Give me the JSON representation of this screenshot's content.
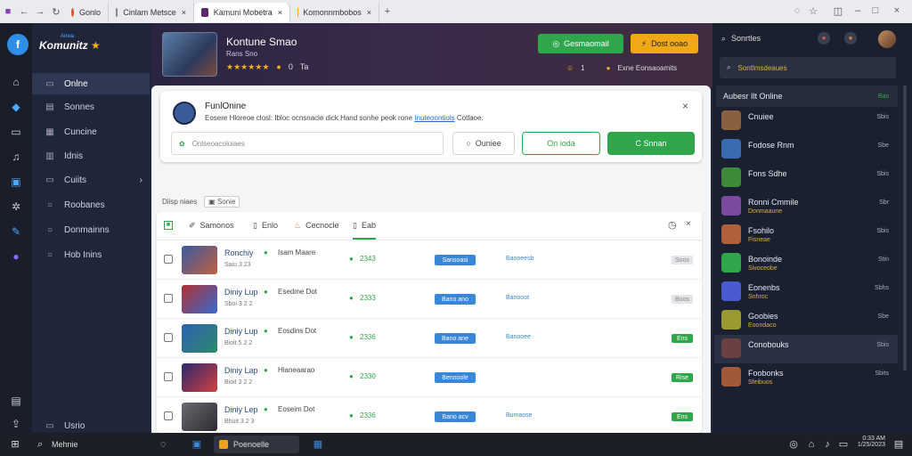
{
  "browser": {
    "tabs": [
      {
        "label": "Gonlo",
        "fav_color": "#d9533b"
      },
      {
        "label": "Cinlam Metsce",
        "fav_color": "#888888"
      },
      {
        "label": "Kamuni Mobetra",
        "fav_color": "#5a2a6a"
      },
      {
        "label": "Komonnmbobos",
        "fav_color": "#f0a020"
      }
    ],
    "new_tab": "+"
  },
  "brand": {
    "name": "Komunitz",
    "tag": "Anwa"
  },
  "sidenav": {
    "items": [
      {
        "label": "Onlne",
        "active": true
      },
      {
        "label": "Sonnes"
      },
      {
        "label": "Cuncine"
      },
      {
        "label": "Idnis"
      },
      {
        "label": "Cuiits",
        "has_arrow": true
      },
      {
        "label": "Roobanes"
      },
      {
        "label": "Donmainns"
      },
      {
        "label": "Hob Inins"
      }
    ],
    "bottom_label": "Usrio"
  },
  "hero": {
    "title": "Kontune Smao",
    "subtitle": "Rans Sno",
    "rating_text": "★★★★★★",
    "coins": "0",
    "meta": "Ta",
    "online_button": "Gesmaomail",
    "action_button": "Dost ooao",
    "stat_count": "1",
    "stat_label": "Exne Eonsaoamits"
  },
  "card": {
    "title": "FunlOnine",
    "description": "Eosere Hloreoe closl: Ibloc ocnsnacle dick Hand sonhe peok rone",
    "link": "Inuteoontiols",
    "description_tail": "Cotlaoe.",
    "input_placeholder": "Onlseoacoloiaes",
    "secondary_button": "Ouniee",
    "outline_button": "On ioda",
    "primary_button": "C Snnan"
  },
  "breadcrumb": {
    "label": "Diisp niaes",
    "chip": "Sonie"
  },
  "table": {
    "tabs": [
      {
        "label": "Samonos"
      },
      {
        "label": "Enlo"
      },
      {
        "label": "Cecnocle"
      },
      {
        "label": "Eab"
      }
    ],
    "rows": [
      {
        "name": "Ronchiy",
        "sub": "Saiu 3 23",
        "tag": "Isam Maare",
        "count": "2343",
        "chip": "Sansoasi",
        "label": "Baoneesb",
        "status": "Soos",
        "status_kind": "grey"
      },
      {
        "name": "Diniy Lup",
        "sub": "Sboi 3 2 2",
        "tag": "Esedme Dot",
        "count": "2333",
        "chip": "Bano ano",
        "label": "Banooot",
        "status": "Boos",
        "status_kind": "grey"
      },
      {
        "name": "Diniy Lup",
        "sub": "Bioit 5 2 2",
        "tag": "Eosdins Dot",
        "count": "2336",
        "chip": "Bano ane",
        "label": "Banooee",
        "status": "Ens",
        "status_kind": "green"
      },
      {
        "name": "Diniy Lap",
        "sub": "Bioit 3 2 2",
        "tag": "Hianeaarao",
        "count": "2330",
        "chip": "Benooole",
        "label": "",
        "status": "Rise",
        "status_kind": "green"
      },
      {
        "name": "Diniy Lep",
        "sub": "Bhuit 3 2 3",
        "tag": "Eoseim Dot",
        "count": "2336",
        "chip": "Bano acv",
        "label": "Bumaose",
        "status": "Ens",
        "status_kind": "green"
      },
      {
        "name": "Diniy Lap",
        "sub": "",
        "tag": "",
        "count": "",
        "chip": "",
        "label": "",
        "status": "",
        "status_kind": "grey"
      }
    ]
  },
  "friends": {
    "search_label": "Sonrtles",
    "search_placeholder": "Sontlmsdeaues",
    "header": "Aubesr Ilt Online",
    "header_count": "Bas",
    "list": [
      {
        "name": "Cnuiee",
        "status": "Sbis",
        "color": "#8a6040"
      },
      {
        "name": "Fodose Rnm",
        "status": "Sbe",
        "color": "#3a6ab0"
      },
      {
        "name": "Fons Sdhe",
        "status": "Sbis",
        "color": "#3f8a3a"
      },
      {
        "name": "Ronni Cmmile",
        "sub": "Donmaaune",
        "status": "Sbr",
        "color": "#7a4aa0"
      },
      {
        "name": "Fsohilo",
        "sub": "Fisneae",
        "status": "Sbis",
        "color": "#b0603a"
      },
      {
        "name": "Bonoinde",
        "sub": "Sivoceobe",
        "status": "Stin",
        "color": "#2fa64a"
      },
      {
        "name": "Eonenbs",
        "sub": "Snhroc",
        "status": "Sbhs",
        "color": "#4a5ad0"
      },
      {
        "name": "Goobies",
        "sub": "Eoondaco",
        "status": "Sbe",
        "color": "#9a9a30"
      },
      {
        "name": "Conobouks",
        "status": "Sbis",
        "color": "#6a4040"
      },
      {
        "name": "Foobonks",
        "sub": "Sfeibuos",
        "status": "Sbits",
        "color": "#a05a3a"
      }
    ]
  },
  "taskbar": {
    "search": "Mehnie",
    "app_label": "Poenoelle",
    "time": "0:33 AM",
    "date": "1/25/2023"
  }
}
